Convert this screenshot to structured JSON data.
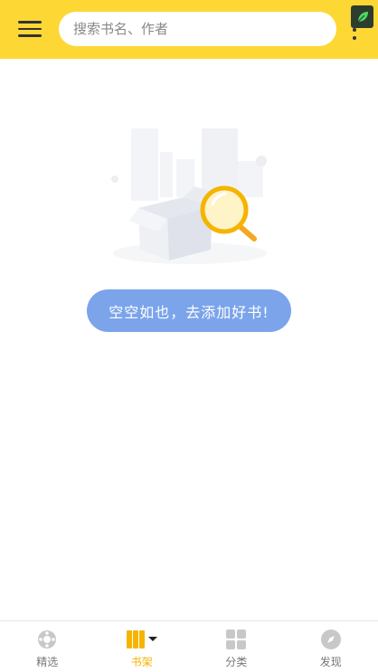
{
  "header": {
    "search_placeholder": "搜索书名、作者",
    "menu_icon": "hamburger-menu-icon",
    "more_icon": "more-vertical-icon",
    "badge_icon": "leaf-icon"
  },
  "empty_state": {
    "illustration": "empty-box-magnifier-illustration",
    "button_label": "空空如也，去添加好书!"
  },
  "bottom_nav": {
    "active": "bookshelf",
    "items": [
      {
        "id": "featured",
        "label": "精选",
        "icon": "gear-flower-icon"
      },
      {
        "id": "bookshelf",
        "label": "书架",
        "icon": "books-icon"
      },
      {
        "id": "categories",
        "label": "分类",
        "icon": "grid-icon"
      },
      {
        "id": "discover",
        "label": "发现",
        "icon": "compass-icon"
      }
    ]
  },
  "colors": {
    "header_bg": "#fdd835",
    "button_bg": "#7ba4ea",
    "active_tab": "#f5b400",
    "inactive_tab": "#777777"
  }
}
